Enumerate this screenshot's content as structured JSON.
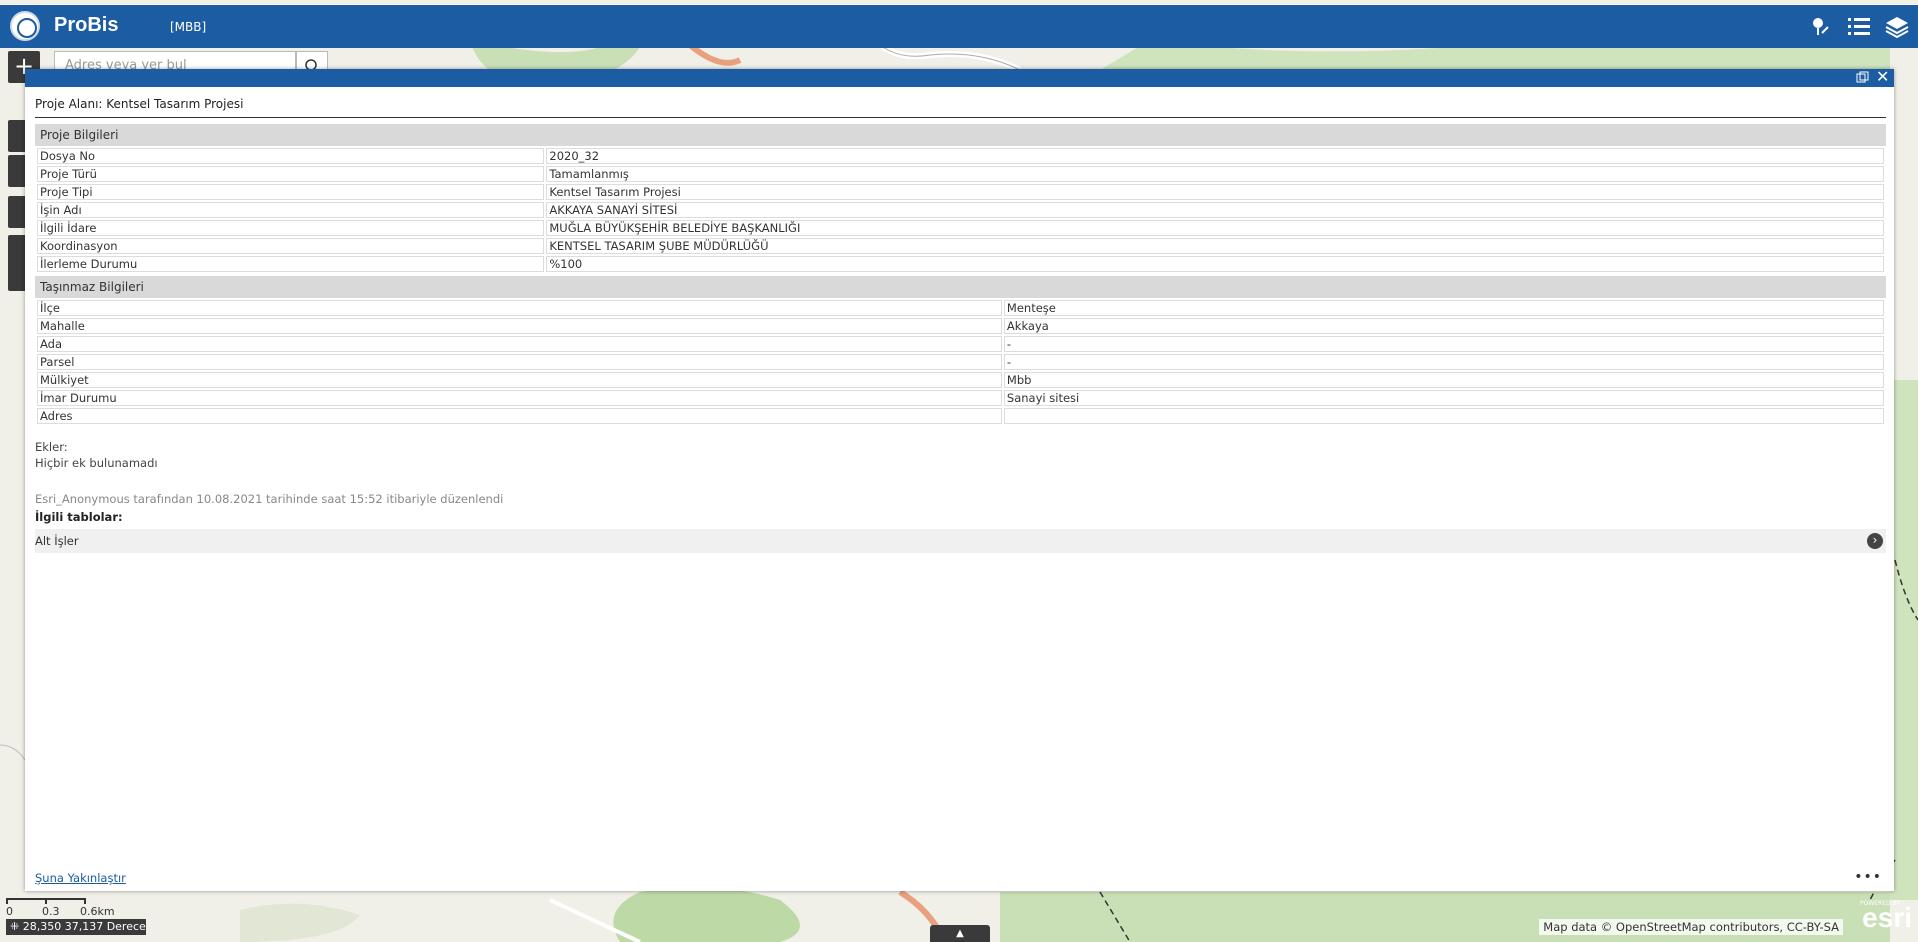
{
  "header": {
    "app_title": "ProBis",
    "app_subtitle": "[MBB]",
    "icons": [
      "location-tool-icon",
      "list-icon",
      "layers-icon"
    ]
  },
  "search": {
    "placeholder": "Adres veya yer bul"
  },
  "popup": {
    "heading": "Proje Alanı: Kentsel Tasarım Projesi",
    "section1_title": "Proje Bilgileri",
    "section1_rows": [
      {
        "label": "Dosya No",
        "value": "2020_32"
      },
      {
        "label": "Proje Türü",
        "value": "Tamamlanmış"
      },
      {
        "label": "Proje Tipi",
        "value": "Kentsel Tasarım Projesi"
      },
      {
        "label": "İşin Adı",
        "value": "AKKAYA SANAYİ SİTESİ"
      },
      {
        "label": "İlgili İdare",
        "value": "MUĞLA BÜYÜKŞEHİR BELEDİYE BAŞKANLIĞI"
      },
      {
        "label": "Koordinasyon",
        "value": "KENTSEL TASARIM ŞUBE MÜDÜRLÜĞÜ"
      },
      {
        "label": "İlerleme Durumu",
        "value": "%100"
      }
    ],
    "section2_title": "Taşınmaz Bilgileri",
    "section2_rows": [
      {
        "label": "İlçe",
        "value": "Menteşe"
      },
      {
        "label": "Mahalle",
        "value": "Akkaya"
      },
      {
        "label": "Ada",
        "value": "-"
      },
      {
        "label": "Parsel",
        "value": "-"
      },
      {
        "label": "Mülkiyet",
        "value": "Mbb"
      },
      {
        "label": "İmar Durumu",
        "value": "Sanayi sitesi"
      },
      {
        "label": "Adres",
        "value": ""
      }
    ],
    "attachments_label": "Ekler:",
    "attachments_empty": "Hiçbir ek bulunamadı",
    "edit_info": "Esri_Anonymous tarafından 10.08.2021 tarihinde saat 15:52 itibariyle düzenlendi",
    "related_label": "İlgili tablolar:",
    "related_item": "Alt İşler",
    "zoom_link": "Şuna Yakınlaştır",
    "more": "•••"
  },
  "map": {
    "scale_labels": [
      "0",
      "0.3",
      "0.6km"
    ],
    "coordinates": "28,350 37,137 Derece",
    "attribution": "Map data © OpenStreetMap contributors, CC-BY-SA",
    "esri_logo": "esri",
    "esri_powered": "POWERED BY"
  },
  "colors": {
    "header": "#1c5ca3",
    "section_bg": "#d9d9d9",
    "link": "#1c5ca3"
  }
}
